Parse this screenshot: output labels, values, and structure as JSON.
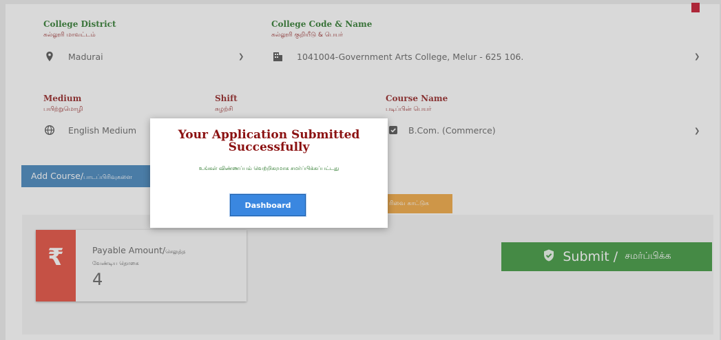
{
  "college_district": {
    "label_en": "College District",
    "label_ta": "கல்லூரி மாவட்டம்",
    "value": "Madurai"
  },
  "college_code_name": {
    "label_en": "College Code & Name",
    "label_ta": "கல்லூரி குறியீடு & பெயர்",
    "value": "1041004-Government Arts College, Melur - 625 106."
  },
  "medium": {
    "label_en": "Medium",
    "label_ta": "பயிற்றுமொழி",
    "value": "English Medium"
  },
  "shift": {
    "label_en": "Shift",
    "label_ta": "சுழற்சி"
  },
  "course_name": {
    "label_en": "Course Name",
    "label_ta": "படிப்பின் பெயர்",
    "value": "B.Com. (Commerce)"
  },
  "add_course": {
    "label_en": "Add Course/",
    "label_ta": "பாடப்பிரிவுகளை"
  },
  "course_list_button": {
    "label_ta": "ரிவை காட்டுக"
  },
  "payment": {
    "label_en": "Payable Amount/",
    "label_en_ta": "செலுத்த",
    "label_ta": "வேண்டிய தொகை",
    "value": "4",
    "icon": "₹"
  },
  "submit": {
    "label_en": "Submit /",
    "label_ta": "சமர்ப்பிக்க"
  },
  "modal": {
    "title": "Your Application Submitted Successfully",
    "message": "உங்கள் விண்ணப்பம் வெற்றிகரமாக சமர்ப்பிக்கப்பட்டது",
    "button": "Dashboard"
  },
  "colors": {
    "accent_red": "#8b1111",
    "label_green": "#1b6e1b",
    "submit_green": "#2b8f2b",
    "add_blue": "#337ab7",
    "orange": "#f0a030",
    "rupee_red": "#e23d2c"
  }
}
